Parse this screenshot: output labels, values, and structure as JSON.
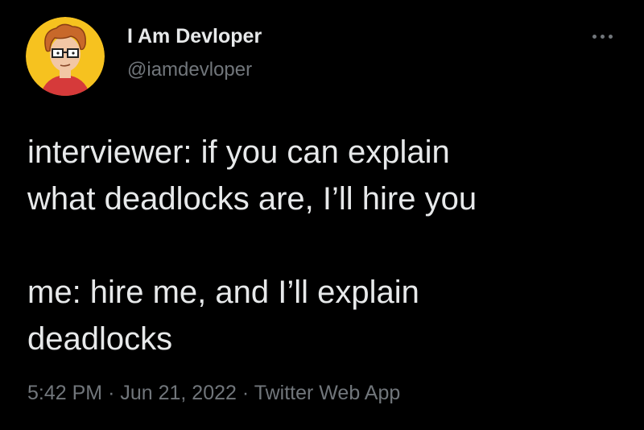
{
  "author": {
    "display_name": "I Am Devloper",
    "handle": "@iamdevloper",
    "avatar_icon": "cartoon-developer-avatar-icon"
  },
  "more_icon": "more-options-icon",
  "tweet": {
    "paragraph_1_line_1": "interviewer: if you can explain",
    "paragraph_1_line_2": "what deadlocks are, I’ll hire you",
    "paragraph_2_line_1": "me: hire me, and I’ll explain",
    "paragraph_2_line_2": "deadlocks"
  },
  "meta": {
    "time": "5:42 PM",
    "separator_1": "·",
    "date": "Jun 21, 2022",
    "separator_2": "·",
    "source": "Twitter Web App"
  },
  "colors": {
    "background": "#000000",
    "primary_text": "#e7e9ea",
    "secondary_text": "#71767b",
    "avatar_background": "#f6c21f"
  }
}
